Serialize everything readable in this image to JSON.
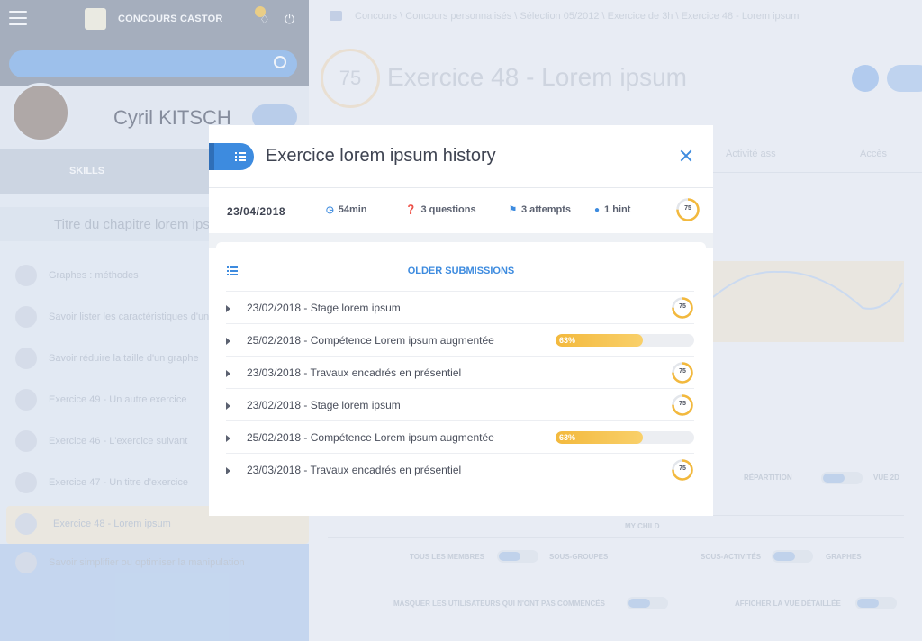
{
  "app": {
    "brand": "CONCOURS CASTOR"
  },
  "user": {
    "name": "Cyril KITSCH"
  },
  "sidebar": {
    "skills_label": "SKILLS",
    "chapter_title": "Titre du chapitre lorem ipsum",
    "items": [
      {
        "label": "Graphes : méthodes"
      },
      {
        "label": "Savoir lister les caractéristiques d'un graphe"
      },
      {
        "label": "Savoir réduire la taille d'un graphe"
      },
      {
        "label": "Exercice 49 - Un autre exercice"
      },
      {
        "label": "Exercice 46 - L'exercice suivant"
      },
      {
        "label": "Exercice 47 - Un titre d'exercice"
      },
      {
        "label": "Exercice 48 - Lorem ipsum"
      },
      {
        "label": "Savoir simplifier ou optimiser la manipulation"
      }
    ]
  },
  "main": {
    "breadcrumb": "Concours \\ Concours personnalisés \\ Sélection 05/2012 \\ Exercice de 3h \\ Exercice 48 - Lorem ipsum",
    "score": "75",
    "title": "Exercice 48 - Lorem ipsum",
    "tabs": [
      {
        "label": "Activité ass"
      },
      {
        "label": "Accès"
      }
    ],
    "mode_label": "MY CHILD",
    "view_label": "VUE 2D",
    "repartition_label": "RÉPARTITION",
    "toggles": [
      {
        "label": "TOUS LES MEMBRES"
      },
      {
        "label": "SOUS-GROUPES"
      },
      {
        "label": "SOUS-ACTIVITÉS"
      },
      {
        "label": "GRAPHES"
      },
      {
        "label": "MASQUER LES UTILISATEURS QUI N'ONT PAS COMMENCÉS"
      },
      {
        "label": "AFFICHER LA VUE DÉTAILLÉE"
      }
    ]
  },
  "modal": {
    "title": "Exercice lorem ipsum history",
    "date": "23/04/2018",
    "stats": {
      "duration": "54min",
      "questions": "3 questions",
      "attempts": "3 attempts",
      "hints": "1 hint"
    },
    "score": "75",
    "score_fraction": 0.75,
    "older_title": "OLDER SUBMISSIONS",
    "submissions": [
      {
        "label": "23/02/2018 - Stage lorem ipsum",
        "kind": "score",
        "score": "75",
        "fraction": 0.75
      },
      {
        "label": "25/02/2018 - Compétence Lorem ipsum augmentée",
        "kind": "progress",
        "percent_label": "63%",
        "fraction": 0.63
      },
      {
        "label": "23/03/2018 - Travaux encadrés en présentiel",
        "kind": "score",
        "score": "75",
        "fraction": 0.75
      },
      {
        "label": "23/02/2018 - Stage lorem ipsum",
        "kind": "score",
        "score": "75",
        "fraction": 0.75
      },
      {
        "label": "25/02/2018 - Compétence Lorem ipsum augmentée",
        "kind": "progress",
        "percent_label": "63%",
        "fraction": 0.63
      },
      {
        "label": "23/03/2018 - Travaux encadrés en présentiel",
        "kind": "score",
        "score": "75",
        "fraction": 0.75
      }
    ]
  },
  "colors": {
    "accent": "#3d8bdf",
    "score_ring": "#f3b93d",
    "ring_track": "#e3e6eb"
  }
}
